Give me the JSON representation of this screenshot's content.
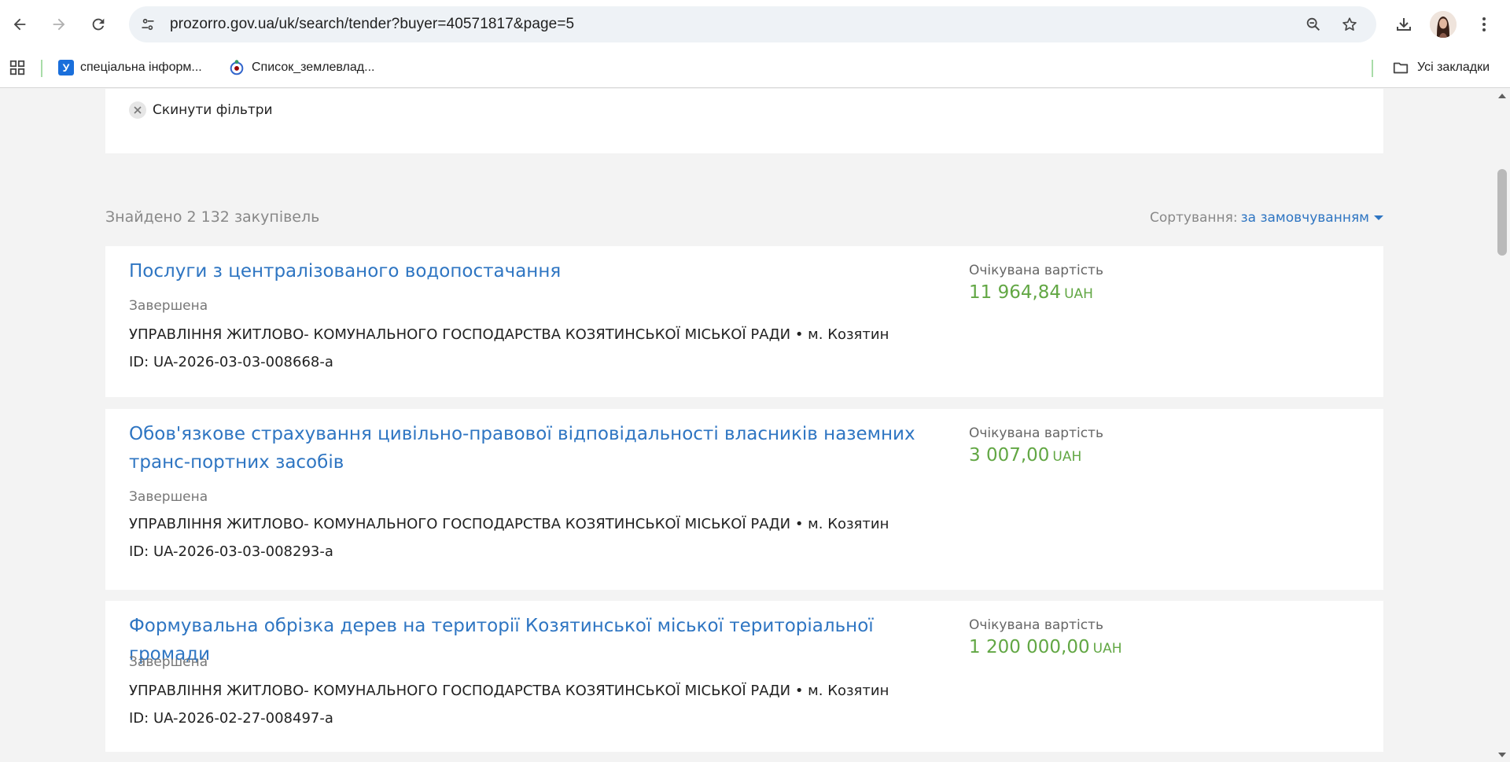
{
  "browser": {
    "url": "prozorro.gov.ua/uk/search/tender?buyer=40571817&page=5",
    "bookmarks": [
      {
        "label": "спеціальна інформ...",
        "icon": "y-favicon"
      },
      {
        "label": "Список_землевлад...",
        "icon": "wikimedia-favicon"
      }
    ],
    "all_bookmarks_label": "Усі закладки"
  },
  "filters": {
    "reset_label": "Скинути фільтри"
  },
  "results": {
    "found_text": "Знайдено 2 132 закупівель",
    "sort_label": "Сортування:",
    "sort_value": "за замовчуванням"
  },
  "tenders": [
    {
      "title": "Послуги з централізованого водопостачання",
      "status": "Завершена",
      "buyer": "УПРАВЛІННЯ ЖИТЛОВО- КОМУНАЛЬНОГО ГОСПОДАРСТВА КОЗЯТИНСЬКОЇ МІСЬКОЇ РАДИ • м. Козятин",
      "id": "ID: UA-2026-03-03-008668-a",
      "price_label": "Очікувана вартість",
      "price": "11 964,84",
      "currency": "UAH"
    },
    {
      "title": "Обов'язкове страхування цивільно-правової відповідальності власників наземних транс-портних засобів",
      "status": "Завершена",
      "buyer": "УПРАВЛІННЯ ЖИТЛОВО- КОМУНАЛЬНОГО ГОСПОДАРСТВА КОЗЯТИНСЬКОЇ МІСЬКОЇ РАДИ • м. Козятин",
      "id": "ID: UA-2026-03-03-008293-a",
      "price_label": "Очікувана вартість",
      "price": "3 007,00",
      "currency": "UAH"
    },
    {
      "title": "Формувальна обрізка дерев на території Козятинської міської територіальної громади",
      "status": "Завершена",
      "buyer": "УПРАВЛІННЯ ЖИТЛОВО- КОМУНАЛЬНОГО ГОСПОДАРСТВА КОЗЯТИНСЬКОЇ МІСЬКОЇ РАДИ • м. Козятин",
      "id": "ID: UA-2026-02-27-008497-a",
      "price_label": "Очікувана вартість",
      "price": "1 200 000,00",
      "currency": "UAH"
    }
  ],
  "colors": {
    "link": "#2e75c2",
    "price": "#62a744",
    "page_bg": "#f3f3f3"
  }
}
